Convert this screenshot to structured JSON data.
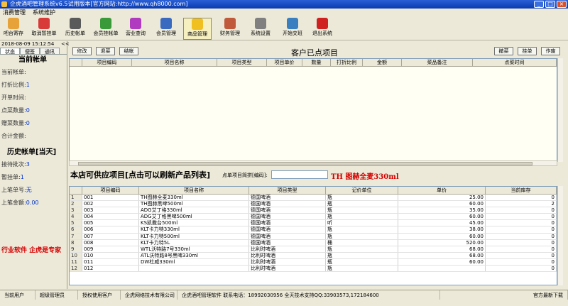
{
  "window": {
    "title": "企虎酒吧管理系统v6.5试用版本[官方网站:http://www.qh8000.com]",
    "controls": [
      "_",
      "□",
      "×"
    ]
  },
  "menu": [
    "消费管理",
    "系统维护"
  ],
  "toolbar": [
    {
      "label": "吧台寄存",
      "icon": "storage-icon",
      "color": "#e8a23a"
    },
    {
      "label": "取消暂挂单",
      "icon": "undo-icon",
      "color": "#d83a3a"
    },
    {
      "label": "历史帐单",
      "icon": "clock-icon",
      "color": "#5a5a5a"
    },
    {
      "label": "会员挂帐单",
      "icon": "member-bill-icon",
      "color": "#3a9a3a"
    },
    {
      "label": "营业查询",
      "icon": "query-icon",
      "color": "#b03ac0"
    },
    {
      "label": "会员管理",
      "icon": "member-icon",
      "color": "#3a6ac0"
    },
    {
      "label": "商品管理",
      "icon": "star-icon",
      "color": "#f0c020"
    },
    {
      "label": "财务管理",
      "icon": "finance-icon",
      "color": "#c05a3a"
    },
    {
      "label": "系统设置",
      "icon": "settings-icon",
      "color": "#808080"
    },
    {
      "label": "开始交班",
      "icon": "handshake-icon",
      "color": "#3a80c0"
    },
    {
      "label": "退出系统",
      "icon": "power-icon",
      "color": "#d02020"
    }
  ],
  "left": {
    "datetime": "2018-08-09 15:12:54",
    "collapse": "<<",
    "tabs": [
      "状态",
      "便签",
      "通讯"
    ],
    "current_title": "当前帐单",
    "current_rows": [
      {
        "label": "当前帐单:",
        "value": ""
      },
      {
        "label": "打折比例:",
        "value": "1"
      },
      {
        "label": "开单时间:",
        "value": ""
      },
      {
        "label": "点菜数量:",
        "value": "0"
      },
      {
        "label": "赠菜数量:",
        "value": "0"
      },
      {
        "label": "合计金额:",
        "value": ""
      }
    ],
    "history_title": "历史帐单[当天]",
    "history_rows": [
      {
        "label": "接待批次:",
        "value": "3"
      },
      {
        "label": "暂挂单:",
        "value": "1"
      },
      {
        "label": "上笔单号:",
        "value": "无"
      },
      {
        "label": "上笔金额:",
        "value": "0.00"
      }
    ],
    "promo": "行业软件  企虎是专家"
  },
  "order": {
    "buttons": [
      "修改",
      "退菜",
      "结帐"
    ],
    "title": "客户已点项目",
    "right_buttons": [
      "撤菜",
      "挂单",
      "作废"
    ],
    "columns": [
      "项目编码",
      "项目名称",
      "项目类型",
      "项目单价",
      "数量",
      "打折比例",
      "金额",
      "菜品备注",
      "点菜时间"
    ]
  },
  "products": {
    "title": "本店可供应项目[点击可以刷新产品列表]",
    "search_label": "点单项目简拼[编码]:",
    "search_value": "",
    "selected": "TH 图赫全麦330ml",
    "columns": [
      "",
      "项目编码",
      "项目名称",
      "项目类型",
      "记价单位",
      "单价",
      "当前库存"
    ],
    "rows": [
      [
        "1",
        "001",
        "TH图赫全麦330ml",
        "德国啤酒",
        "瓶",
        "25.00",
        "0"
      ],
      [
        "2",
        "002",
        "TH图赫黑啤500ml",
        "德国啤酒",
        "瓶",
        "60.00",
        "2"
      ],
      [
        "3",
        "003",
        "ADG艾丁格330ml",
        "德国啤酒",
        "瓶",
        "35.00",
        "0"
      ],
      [
        "4",
        "004",
        "ADG艾丁格黑啤500ml",
        "德国啤酒",
        "瓶",
        "60.00",
        "0"
      ],
      [
        "5",
        "005",
        "KS凯撒台500ml",
        "德国啤酒",
        "听",
        "45.00",
        "0"
      ],
      [
        "6",
        "006",
        "KLT卡力特330ml",
        "德国啤酒",
        "瓶",
        "38.00",
        "0"
      ],
      [
        "7",
        "007",
        "KLT卡力特500ml",
        "德国啤酒",
        "瓶",
        "60.00",
        "0"
      ],
      [
        "8",
        "008",
        "KLT卡力特5L",
        "德国啤酒",
        "桶",
        "520.00",
        "0"
      ],
      [
        "9",
        "009",
        "WTL沃特路7号330ml",
        "比利时啤酒",
        "瓶",
        "68.00",
        "0"
      ],
      [
        "10",
        "010",
        "ATL沃特路8号黑啤330ml",
        "比利时啤酒",
        "瓶",
        "68.00",
        "0"
      ],
      [
        "11",
        "011",
        "DW杜威330ml",
        "比利时啤酒",
        "瓶",
        "60.00",
        "0"
      ],
      [
        "12",
        "012",
        "",
        "比利时啤酒",
        "瓶",
        "",
        "0"
      ]
    ]
  },
  "status": [
    "当前用户",
    "超级管理员",
    "授权使用客户",
    "企虎网络技术有限公司",
    "企虎酒吧管理软件  联系电话：18992030956  全天技术支持QQ:33903573,172184600",
    "官方最新下载"
  ]
}
